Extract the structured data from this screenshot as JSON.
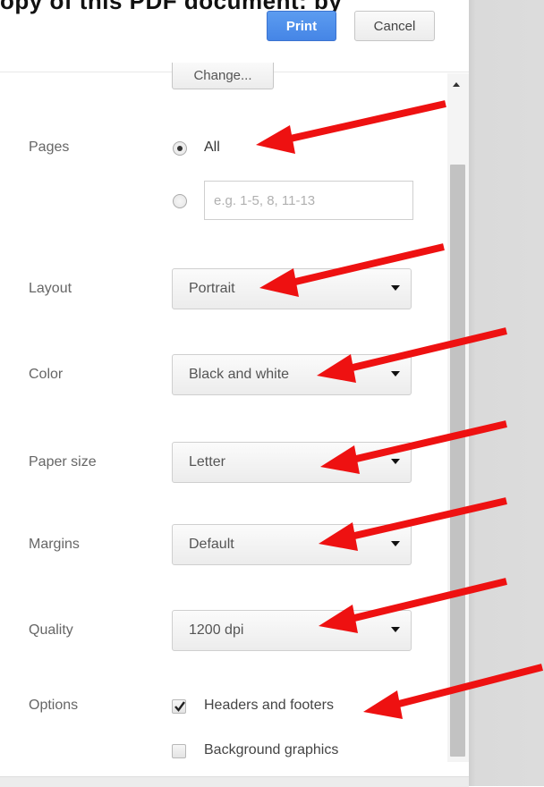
{
  "top_caption": "opy of this PDF document: by",
  "header": {
    "print_label": "Print",
    "cancel_label": "Cancel",
    "change_label": "Change..."
  },
  "pages": {
    "label": "Pages",
    "all_label": "All",
    "custom_placeholder": "e.g. 1-5, 8, 11-13",
    "custom_value": ""
  },
  "layout": {
    "label": "Layout",
    "value": "Portrait"
  },
  "color": {
    "label": "Color",
    "value": "Black and white"
  },
  "paper_size": {
    "label": "Paper size",
    "value": "Letter"
  },
  "margins": {
    "label": "Margins",
    "value": "Default"
  },
  "quality": {
    "label": "Quality",
    "value": "1200 dpi"
  },
  "options": {
    "label": "Options",
    "headers_footers_label": "Headers and footers",
    "headers_footers_checked": true,
    "background_graphics_label": "Background graphics",
    "background_graphics_checked": false
  },
  "colors": {
    "accent": "#4a89e8",
    "annotation_arrow": "#ee1111",
    "right_panel": "#dcdcdc"
  }
}
